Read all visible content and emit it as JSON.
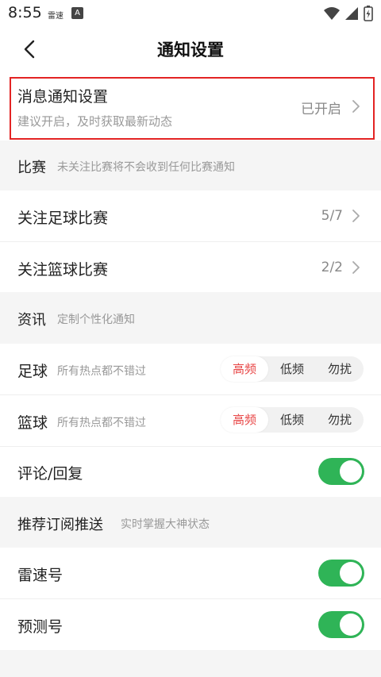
{
  "status_bar": {
    "time": "8:55",
    "app_label": "雷速",
    "notification_badge": "A"
  },
  "nav": {
    "title": "通知设置"
  },
  "message_notification": {
    "title": "消息通知设置",
    "subtitle": "建议开启，及时获取最新动态",
    "status": "已开启"
  },
  "match_section": {
    "title": "比赛",
    "subtitle": "未关注比赛将不会收到任何比赛通知",
    "items": [
      {
        "label": "关注足球比赛",
        "value": "5/7"
      },
      {
        "label": "关注篮球比赛",
        "value": "2/2"
      }
    ]
  },
  "news_section": {
    "title": "资讯",
    "subtitle": "定制个性化通知",
    "items": [
      {
        "label": "足球",
        "subtitle": "所有热点都不错过",
        "options": [
          "高频",
          "低频",
          "勿扰"
        ],
        "selected": "高频"
      },
      {
        "label": "篮球",
        "subtitle": "所有热点都不错过",
        "options": [
          "高频",
          "低频",
          "勿扰"
        ],
        "selected": "高频"
      },
      {
        "label": "评论/回复",
        "enabled": true
      }
    ]
  },
  "subscribe_section": {
    "title": "推荐订阅推送",
    "subtitle": "实时掌握大神状态",
    "items": [
      {
        "label": "雷速号",
        "enabled": true
      },
      {
        "label": "预测号",
        "enabled": true
      }
    ]
  },
  "colors": {
    "accent_red": "#e84545",
    "toggle_green": "#2fb457",
    "highlight_border": "#e32424"
  }
}
